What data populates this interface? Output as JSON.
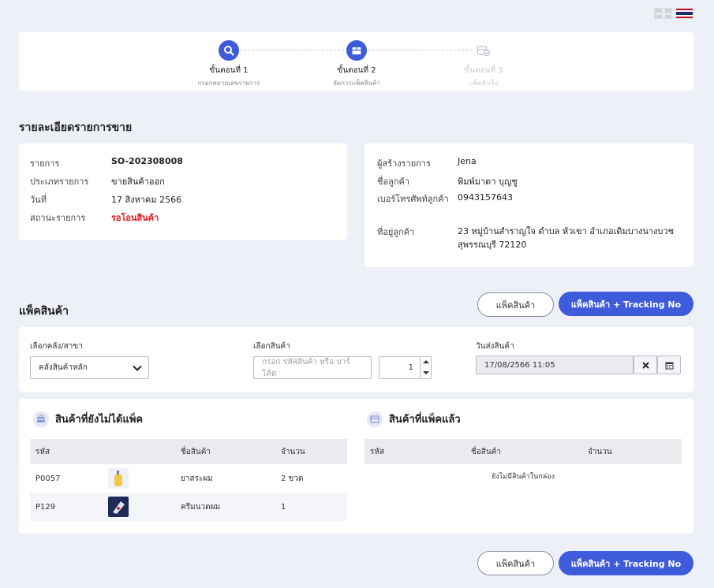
{
  "steps": [
    {
      "title": "ขั้นตอนที่ 1",
      "subtitle": "กรอกหมายเลขรายการ"
    },
    {
      "title": "ขั้นตอนที่ 2",
      "subtitle": "จัดการแพ็คสินค้า"
    },
    {
      "title": "ขั้นตอนที่ 3",
      "subtitle": "แพ็คสำเร็จ"
    }
  ],
  "sale_details": {
    "title": "รายละเอียดรายการขาย",
    "left": [
      {
        "label": "รายการ",
        "value": "SO-202308008"
      },
      {
        "label": "ประเภทรายการ",
        "value": "ขายสินค้าออก"
      },
      {
        "label": "วันที่",
        "value": "17 สิงหาคม 2566"
      },
      {
        "label": "สถานะรายการ",
        "value": "รอโอนสินค้า"
      }
    ],
    "right": [
      {
        "label": "ผู้สร้างรายการ",
        "value": "Jena"
      },
      {
        "label": "ชื่อลูกค้า",
        "value": "พิมพ์มาดา บุญชู"
      },
      {
        "label": "เบอร์โทรศัพท์ลูกค้า",
        "value": "0943157643"
      },
      {
        "label": "ที่อยู่ลูกค้า",
        "value": "23 หมู่บ้านสำราญใจ ตำบล หัวเขา อำเภอเดิมบางนางบวช สุพรรณบุรี 72120"
      }
    ],
    "status_color": "#e0161b"
  },
  "pack": {
    "title": "แพ็คสินค้า",
    "pack_button": "แพ็คสินค้า",
    "pack_tracking_button": "แพ็คสินค้า + Tracking No",
    "warehouse_label": "เลือกคลัง/สาขา",
    "warehouse_value": "คลังสินค้าหลัก",
    "product_label": "เลือกสินค้า",
    "product_placeholder": "กรอก รหัสสินค้า หรือ บาร์โค้ด",
    "quantity": "1",
    "ship_date_label": "วันส่งสินค้า",
    "ship_date_value": "17/08/2566 11:05"
  },
  "unpacked": {
    "title": "สินค้าที่ยังไม่ได้แพ็ค",
    "columns": [
      "รหัส",
      "ชื่อสินค้า",
      "จำนวน"
    ],
    "rows": [
      {
        "code": "P0057",
        "name": "ยาสระผม",
        "qty": "2 ขวด"
      },
      {
        "code": "P129",
        "name": "ครีมนวดผม",
        "qty": "1"
      }
    ]
  },
  "packed": {
    "title": "สินค้าที่แพ็คแล้ว",
    "columns": [
      "รหัส",
      "ชื่อสินค้า",
      "จำนวน"
    ],
    "empty": "ยังไม่มีสินค้าในกล่อง"
  },
  "colors": {
    "accent": "#3d5bdb",
    "background": "#eef0f7"
  }
}
